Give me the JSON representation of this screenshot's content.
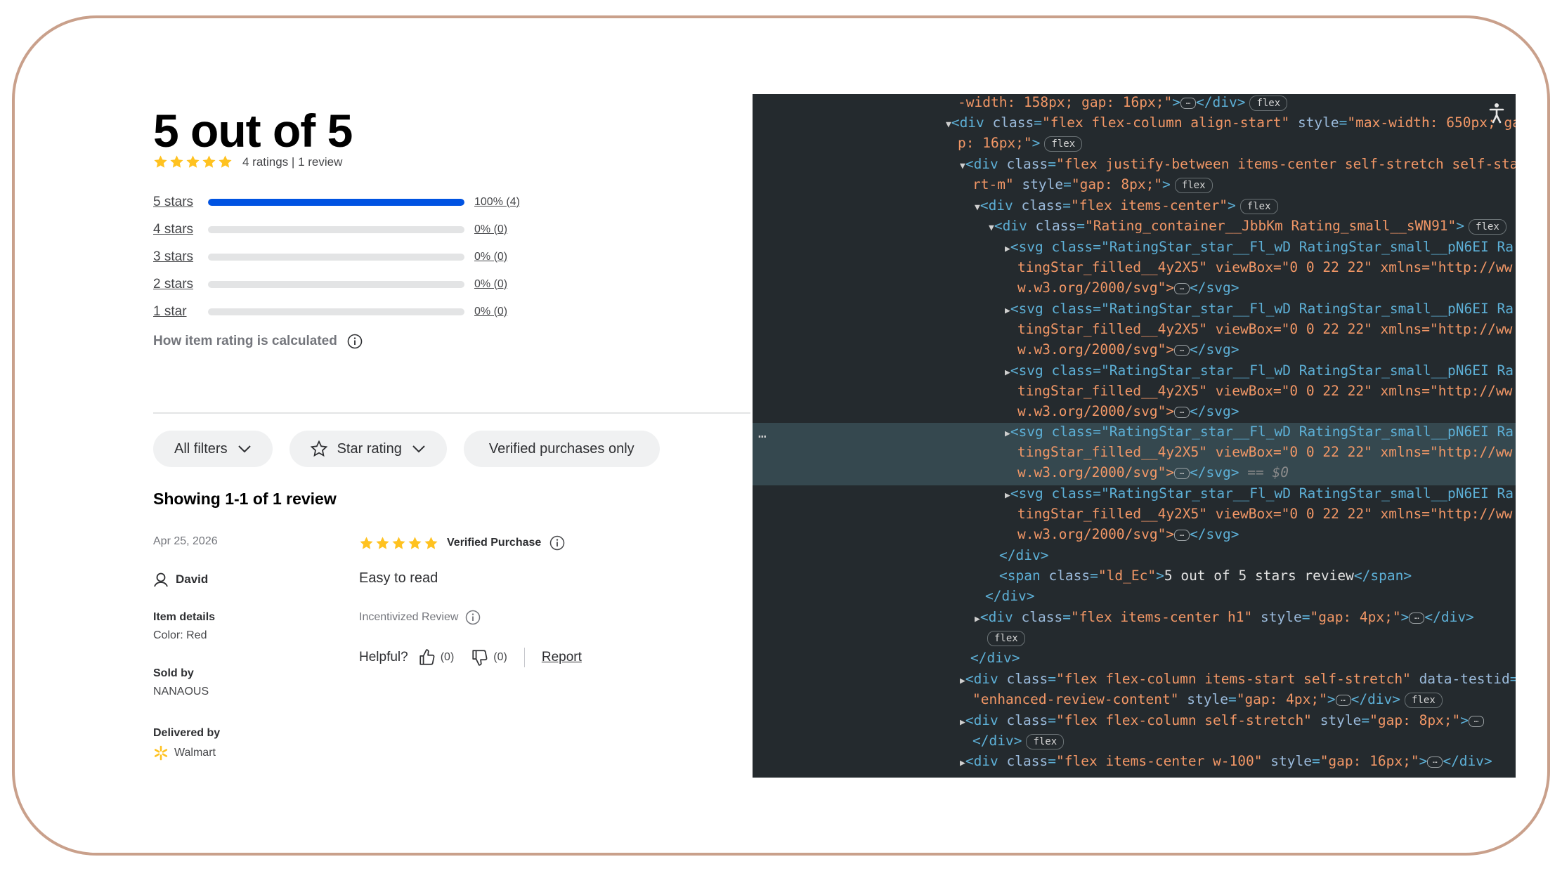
{
  "summary": {
    "title": "5 out of 5",
    "rating": 5,
    "ratings_text": "4 ratings",
    "reviews_text": "1 review",
    "breakdown": [
      {
        "label": "5 stars",
        "fraction": 1.0,
        "pct_text": "100% (4)"
      },
      {
        "label": "4 stars",
        "fraction": 0.0,
        "pct_text": "0% (0)"
      },
      {
        "label": "3 stars",
        "fraction": 0.0,
        "pct_text": "0% (0)"
      },
      {
        "label": "2 stars",
        "fraction": 0.0,
        "pct_text": "0% (0)"
      },
      {
        "label": "1 star",
        "fraction": 0.0,
        "pct_text": "0% (0)"
      }
    ],
    "how_calculated": "How item rating is calculated"
  },
  "filters": {
    "all_filters": "All filters",
    "star_rating": "Star rating",
    "verified_only": "Verified purchases only"
  },
  "showing": "Showing 1-1 of 1 review",
  "review": {
    "date": "Apr 25, 2026",
    "user": "David",
    "item_details_label": "Item details",
    "item_details_value": "Color: Red",
    "sold_by_label": "Sold by",
    "sold_by_value": "NANAOUS",
    "delivered_by_label": "Delivered by",
    "delivered_by_value": "Walmart",
    "rating": 5,
    "verified": "Verified Purchase",
    "text": "Easy to read",
    "incentivized": "Incentivized Review",
    "helpful_label": "Helpful?",
    "up_count": "(0)",
    "down_count": "(0)",
    "report": "Report"
  },
  "colors": {
    "star": "#ffc220",
    "bar_fill": "#0053e2",
    "devtools_bg": "#242a2e",
    "highlight": "#35484f",
    "frame_border": "#c9a08b"
  },
  "devtools": {
    "badge": "flex",
    "svg_text": "<svg class=\"RatingStar_star__Fl_wD RatingStar_small__pN6EI Ra",
    "svg_text2": "tingStar_filled__4y2X5\" viewBox=\"0 0 22 22\" xmlns=\"http://ww",
    "svg_text3": "w.w3.org/2000/svg\">",
    "selected_marker": "== $0",
    "span_text": "5 out of 5 stars review"
  }
}
